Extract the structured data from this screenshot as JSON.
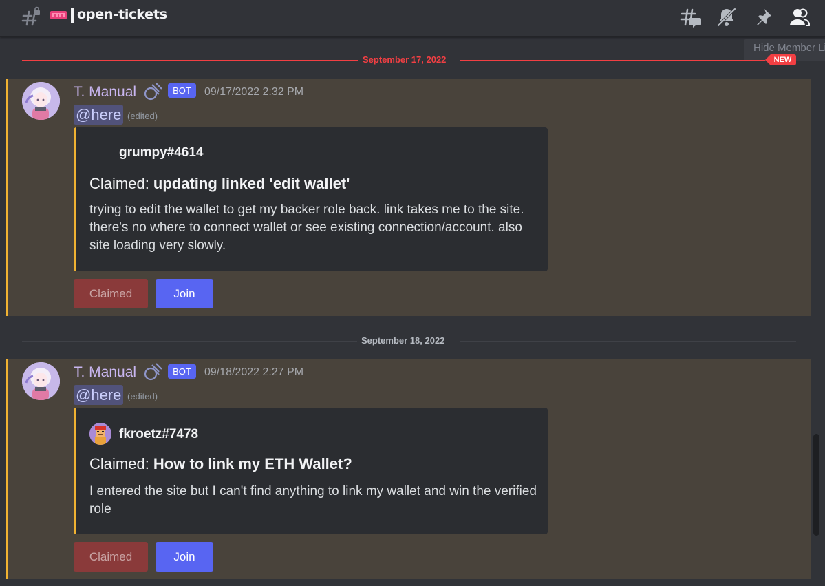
{
  "header": {
    "channel_emoji": "ticket-icon",
    "channel_name": "open-tickets",
    "tooltip": "Hide Member List",
    "icons": [
      "threads-icon",
      "bell-muted-icon",
      "pin-icon",
      "members-icon"
    ]
  },
  "dividers": [
    {
      "date": "September 17, 2022",
      "new_badge": "NEW"
    },
    {
      "date": "September 18, 2022"
    }
  ],
  "messages": [
    {
      "author": "T. Manual",
      "bot_tag": "BOT",
      "timestamp": "09/17/2022 2:32 PM",
      "mention": "@here",
      "edited": "(edited)",
      "embed": {
        "author": "grumpy#4614",
        "title_prefix": "Claimed: ",
        "title_bold": "updating linked 'edit wallet'",
        "description": "trying to edit the wallet to get my backer role back. link takes me to the site. there's no where to connect wallet or see existing connection/account. also site loading very slowly."
      },
      "buttons": {
        "claimed": "Claimed",
        "join": "Join"
      }
    },
    {
      "author": "T. Manual",
      "bot_tag": "BOT",
      "timestamp": "09/18/2022 2:27 PM",
      "mention": "@here",
      "edited": "(edited)",
      "embed": {
        "author": "fkroetz#7478",
        "title_prefix": "Claimed: ",
        "title_bold": "How to link my ETH Wallet?",
        "description": "I entered the site but I can't find anything to link my wallet and win the verified role"
      },
      "buttons": {
        "claimed": "Claimed",
        "join": "Join"
      }
    }
  ],
  "colors": {
    "background": "#313338",
    "highlight": "#49433b",
    "accent_bar": "#f0b232",
    "new_red": "#f23f43",
    "blurple": "#5865f2",
    "claimed_red": "#8a3a3a"
  }
}
